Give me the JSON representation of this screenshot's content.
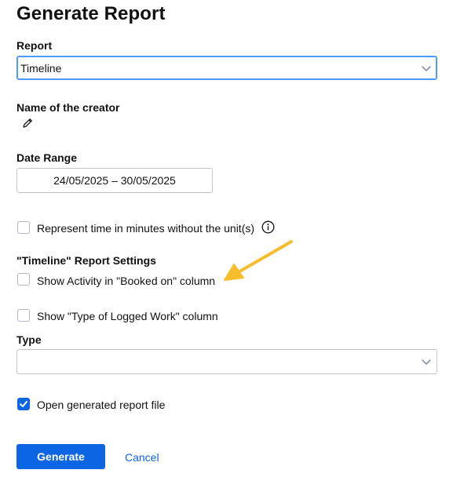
{
  "page": {
    "title": "Generate Report"
  },
  "report": {
    "label": "Report",
    "selected": "Timeline"
  },
  "creator": {
    "label": "Name of the creator",
    "icon": "pencil-icon"
  },
  "date_range": {
    "label": "Date Range",
    "value": "24/05/2025 – 30/05/2025"
  },
  "options": {
    "minutes_label": "Represent time in minutes without the unit(s)",
    "minutes_checked": false,
    "info_icon": "info-icon"
  },
  "timeline_settings": {
    "heading": "\"Timeline\" Report Settings",
    "activity_label": "Show Activity in \"Booked on\" column",
    "activity_checked": false,
    "type_logged_label": "Show \"Type of Logged Work\" column",
    "type_logged_checked": false
  },
  "type": {
    "label": "Type",
    "selected": ""
  },
  "open_file": {
    "label": "Open generated report file",
    "checked": true
  },
  "actions": {
    "generate_label": "Generate",
    "cancel_label": "Cancel"
  },
  "annotation": {
    "arrow_color": "#f6be2c"
  },
  "colors": {
    "primary": "#0c66e4",
    "focus_border": "#4c9aff",
    "text": "#111111"
  }
}
